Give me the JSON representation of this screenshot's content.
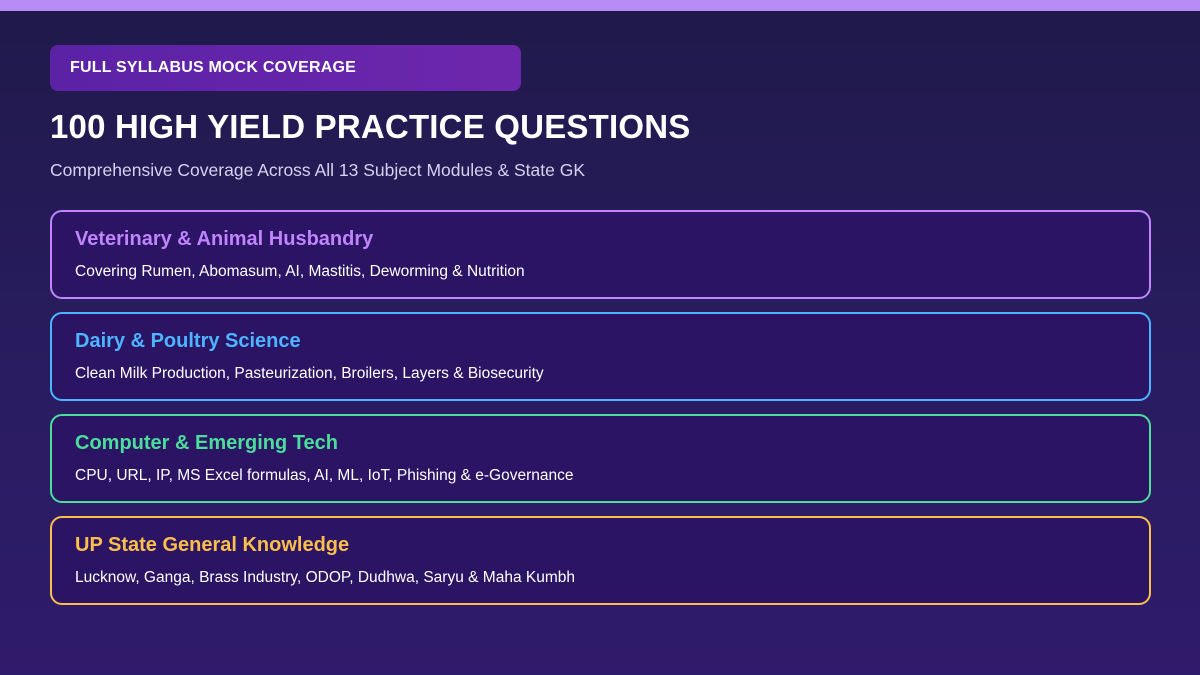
{
  "colors": {
    "top_bar": "#b78cf7",
    "badge_bg": "#6326aa",
    "background": "#251b56"
  },
  "badge": {
    "label": "FULL SYLLABUS MOCK COVERAGE"
  },
  "headline": "100 HIGH YIELD PRACTICE QUESTIONS",
  "subheadline": "Comprehensive Coverage Across All 13 Subject Modules & State GK",
  "modules": [
    {
      "title": "Veterinary & Animal Husbandry",
      "description": "Covering Rumen, Abomasum, AI, Mastitis, Deworming & Nutrition",
      "accent": "#c084fc"
    },
    {
      "title": "Dairy & Poultry Science",
      "description": "Clean Milk Production, Pasteurization, Broilers, Layers & Biosecurity",
      "accent": "#4db5ff"
    },
    {
      "title": "Computer & Emerging Tech",
      "description": "CPU, URL, IP, MS Excel formulas, AI, ML, IoT, Phishing & e-Governance",
      "accent": "#4ade9a"
    },
    {
      "title": "UP State General Knowledge",
      "description": "Lucknow, Ganga, Brass Industry, ODOP, Dudhwa, Saryu & Maha Kumbh",
      "accent": "#fbbf4a"
    }
  ]
}
